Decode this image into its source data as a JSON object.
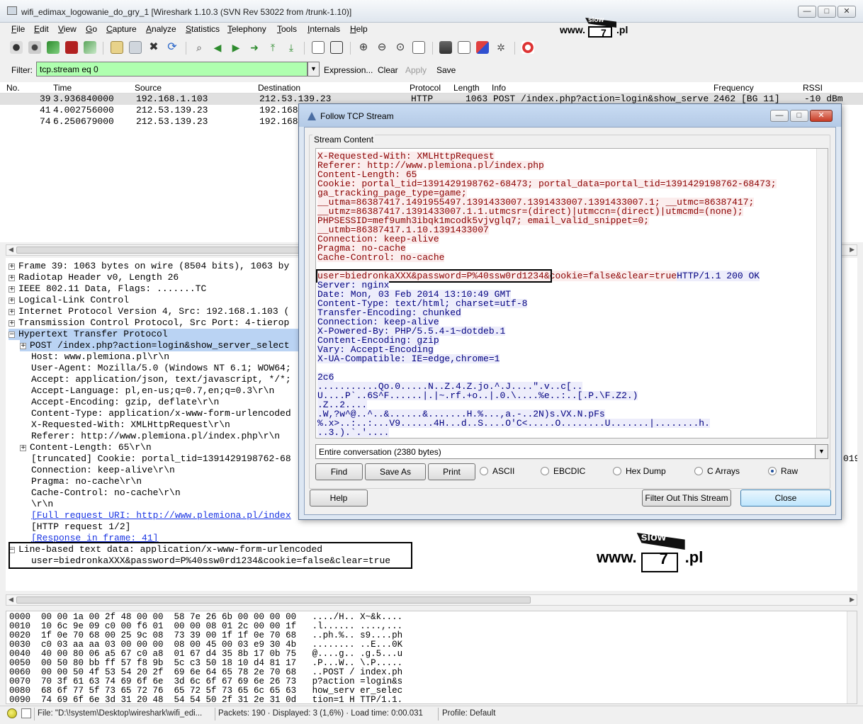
{
  "window": {
    "title": "wifi_edimax_logowanie_do_gry_1  [Wireshark 1.10.3  (SVN Rev 53022 from /trunk-1.10)]",
    "min": "—",
    "max": "□",
    "close": "✕"
  },
  "menu": [
    "File",
    "Edit",
    "View",
    "Go",
    "Capture",
    "Analyze",
    "Statistics",
    "Telephony",
    "Tools",
    "Internals",
    "Help"
  ],
  "logo": {
    "prefix": "www.",
    "sign_top": "slow",
    "sign_num": "7",
    "suffix": ".pl"
  },
  "filter": {
    "label": "Filter:",
    "value": "tcp.stream eq 0",
    "expression": "Expression...",
    "clear": "Clear",
    "apply": "Apply",
    "save": "Save"
  },
  "packet_list": {
    "columns": [
      "No.",
      "Time",
      "Source",
      "Destination",
      "Protocol",
      "Length",
      "Info",
      "Frequency",
      "RSSI"
    ],
    "rows": [
      {
        "no": "39",
        "time": "3.936840000",
        "source": "192.168.1.103",
        "destination": "212.53.139.23",
        "protocol": "HTTP",
        "length": "1063",
        "info": "POST /index.php?action=login&show_serve",
        "frequency": "2462 [BG 11]",
        "rssi": "-10 dBm"
      },
      {
        "no": "41",
        "time": "4.002756000",
        "source": "212.53.139.23",
        "destination": "192.168",
        "protocol": "",
        "length": "",
        "info": "",
        "frequency": "",
        "rssi": ""
      },
      {
        "no": "74",
        "time": "6.250679000",
        "source": "212.53.139.23",
        "destination": "192.168",
        "protocol": "",
        "length": "",
        "info": "",
        "frequency": "",
        "rssi": ""
      }
    ]
  },
  "detail_tree": [
    {
      "exp": "+",
      "text": "Frame 39: 1063 bytes on wire (8504 bits), 1063 by"
    },
    {
      "exp": "+",
      "text": "Radiotap Header v0, Length 26"
    },
    {
      "exp": "+",
      "text": "IEEE 802.11 Data, Flags: .......TC"
    },
    {
      "exp": "+",
      "text": "Logical-Link Control"
    },
    {
      "exp": "+",
      "text": "Internet Protocol Version 4, Src: 192.168.1.103 ("
    },
    {
      "exp": "+",
      "text": "Transmission Control Protocol, Src Port: 4-tierop"
    },
    {
      "exp": "−",
      "text": "Hypertext Transfer Protocol"
    },
    {
      "exp": "+",
      "text": "POST /index.php?action=login&show_server_select"
    },
    {
      "exp": "",
      "text": "Host: www.plemiona.pl\\r\\n"
    },
    {
      "exp": "",
      "text": "User-Agent: Mozilla/5.0 (Windows NT 6.1; WOW64;"
    },
    {
      "exp": "",
      "text": "Accept: application/json, text/javascript, */*;"
    },
    {
      "exp": "",
      "text": "Accept-Language: pl,en-us;q=0.7,en;q=0.3\\r\\n"
    },
    {
      "exp": "",
      "text": "Accept-Encoding: gzip, deflate\\r\\n"
    },
    {
      "exp": "",
      "text": "Content-Type: application/x-www-form-urlencoded"
    },
    {
      "exp": "",
      "text": "X-Requested-With: XMLHttpRequest\\r\\n"
    },
    {
      "exp": "",
      "text": "Referer: http://www.plemiona.pl/index.php\\r\\n"
    },
    {
      "exp": "+",
      "text": "Content-Length: 65\\r\\n"
    },
    {
      "exp": "",
      "text": "[truncated] Cookie: portal_tid=1391429198762-68"
    },
    {
      "exp": "",
      "text": "Connection: keep-alive\\r\\n"
    },
    {
      "exp": "",
      "text": "Pragma: no-cache\\r\\n"
    },
    {
      "exp": "",
      "text": "Cache-Control: no-cache\\r\\n"
    },
    {
      "exp": "",
      "text": "\\r\\n"
    },
    {
      "exp": "",
      "text": "[Full request URI: http://www.plemiona.pl/index"
    },
    {
      "exp": "",
      "text": "[HTTP request 1/2]"
    },
    {
      "exp": "",
      "text": "[Response in frame: 41]"
    },
    {
      "exp": "−",
      "text": "Line-based text data: application/x-www-form-urlencoded"
    },
    {
      "exp": "",
      "text": "user=biedronkaXXX&password=P%40ssw0rd1234&cookie=false&clear=true"
    }
  ],
  "detail_right_fragment": "019",
  "hex_dump": [
    "0000  00 00 1a 00 2f 48 00 00  58 7e 26 6b 00 00 00 00   ..../H.. X~&k....",
    "0010  10 6c 9e 09 c0 00 f6 01  00 00 08 01 2c 00 00 1f   .l...... ....,...",
    "0020  1f 0e 70 68 00 25 9c 08  73 39 00 1f 1f 0e 70 68   ..ph.%.. s9....ph",
    "0030  c0 03 aa aa 03 00 00 00  08 00 45 00 03 e9 30 4b   ........ ..E...0K",
    "0040  40 00 80 06 a5 67 c0 a8  01 67 d4 35 8b 17 0b 75   @....g.. .g.5...u",
    "0050  00 50 80 bb ff 57 f8 9b  5c c3 50 18 10 d4 81 17   .P...W.. \\.P.....",
    "0060  00 00 50 4f 53 54 20 2f  69 6e 64 65 78 2e 70 68   ..POST / index.ph",
    "0070  70 3f 61 63 74 69 6f 6e  3d 6c 6f 67 69 6e 26 73   p?action =login&s",
    "0080  68 6f 77 5f 73 65 72 76  65 72 5f 73 65 6c 65 63   how_serv er_selec",
    "0090  74 69 6f 6e 3d 31 20 48  54 54 50 2f 31 2e 31 0d   tion=1 H TTP/1.1."
  ],
  "status": {
    "file": "File: \"D:\\!system\\Desktop\\wireshark\\wifi_edi...",
    "packets": "Packets: 190 · Displayed: 3 (1,6%) · Load time: 0:00.031",
    "profile": "Profile: Default"
  },
  "dialog": {
    "title": "Follow TCP Stream",
    "group_label": "Stream Content",
    "lines": [
      {
        "c": "red",
        "t": "X-Requested-With: XMLHttpRequest"
      },
      {
        "c": "red",
        "t": "Referer: http://www.plemiona.pl/index.php"
      },
      {
        "c": "red",
        "t": "Content-Length: 65"
      },
      {
        "c": "red",
        "t": "Cookie: portal_tid=1391429198762-68473; portal_data=portal_tid=1391429198762-68473;"
      },
      {
        "c": "red",
        "t": "ga_tracking_page_type=game;"
      },
      {
        "c": "red",
        "t": "__utma=86387417.1491955497.1391433007.1391433007.1391433007.1; __utmc=86387417;"
      },
      {
        "c": "red",
        "t": "__utmz=86387417.1391433007.1.1.utmcsr=(direct)|utmccn=(direct)|utmcmd=(none);"
      },
      {
        "c": "red",
        "t": "PHPSESSID=mef9umh3ibqk1mcodk5vjvglq7; email_valid_snippet=0;"
      },
      {
        "c": "red",
        "t": "__utmb=86387417.1.10.1391433007"
      },
      {
        "c": "red",
        "t": "Connection: keep-alive"
      },
      {
        "c": "red",
        "t": "Pragma: no-cache"
      },
      {
        "c": "red",
        "t": "Cache-Control: no-cache"
      },
      {
        "c": "",
        "t": ""
      },
      {
        "c": "mixed",
        "r": "user=biedronkaXXX&password=P%40ssw0rd1234&cookie=false&clear=true",
        "b": "HTTP/1.1 200 OK"
      },
      {
        "c": "blue",
        "t": "Server: nginx"
      },
      {
        "c": "blue",
        "t": "Date: Mon, 03 Feb 2014 13:10:49 GMT"
      },
      {
        "c": "blue",
        "t": "Content-Type: text/html; charset=utf-8"
      },
      {
        "c": "blue",
        "t": "Transfer-Encoding: chunked"
      },
      {
        "c": "blue",
        "t": "Connection: keep-alive"
      },
      {
        "c": "blue",
        "t": "X-Powered-By: PHP/5.5.4-1~dotdeb.1"
      },
      {
        "c": "blue",
        "t": "Content-Encoding: gzip"
      },
      {
        "c": "blue",
        "t": "Vary: Accept-Encoding"
      },
      {
        "c": "blue",
        "t": "X-UA-Compatible: IE=edge,chrome=1"
      },
      {
        "c": "blue",
        "t": ""
      },
      {
        "c": "blue",
        "t": "2c6"
      },
      {
        "c": "blue",
        "t": "...........Qo.0.....N..Z.4.Z.jo.^.J....\".v..c[.."
      },
      {
        "c": "blue",
        "t": "U....P`..6S^F......|.|~.rf.+o..|.0.\\....%e..:..[.P.\\F.Z2.)"
      },
      {
        "c": "blue",
        "t": ".Z..2...."
      },
      {
        "c": "blue",
        "t": ".W,?w^@..^..&......&.......H.%...,a.-..2N)s.VX.N.pFs"
      },
      {
        "c": "blue",
        "t": "%.x>..:..:...V9......4H...d..S....O'C<.....O........U.......|........h."
      },
      {
        "c": "blue",
        "t": "..3.).`.'...."
      }
    ],
    "conversation": "Entire conversation (2380 bytes)",
    "buttons": {
      "find": "Find",
      "save_as": "Save As",
      "print": "Print",
      "help": "Help",
      "filter_out": "Filter Out This Stream",
      "close": "Close"
    },
    "radios": [
      "ASCII",
      "EBCDIC",
      "Hex Dump",
      "C Arrays",
      "Raw"
    ],
    "selected_radio": "Raw"
  }
}
